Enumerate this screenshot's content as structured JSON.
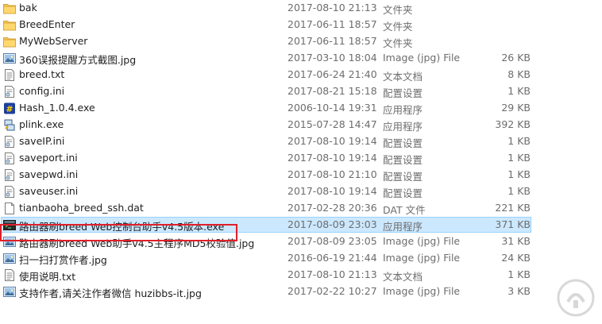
{
  "files": [
    {
      "name": "bak",
      "date": "2017-08-10 21:13",
      "type": "文件夹",
      "size": "",
      "icon": "folder-icon"
    },
    {
      "name": "BreedEnter",
      "date": "2017-06-11 18:57",
      "type": "文件夹",
      "size": "",
      "icon": "folder-icon"
    },
    {
      "name": "MyWebServer",
      "date": "2017-06-11 18:57",
      "type": "文件夹",
      "size": "",
      "icon": "folder-icon"
    },
    {
      "name": "360误报提醒方式截图.jpg",
      "date": "2017-03-10 18:04",
      "type": "Image (jpg) File",
      "size": "26 KB",
      "icon": "image-file-icon"
    },
    {
      "name": "breed.txt",
      "date": "2017-06-24 21:40",
      "type": "文本文档",
      "size": "8 KB",
      "icon": "text-file-icon"
    },
    {
      "name": "config.ini",
      "date": "2017-08-21 15:18",
      "type": "配置设置",
      "size": "1 KB",
      "icon": "settings-file-icon"
    },
    {
      "name": "Hash_1.0.4.exe",
      "date": "2006-10-14 19:31",
      "type": "应用程序",
      "size": "29 KB",
      "icon": "hash-app-icon"
    },
    {
      "name": "plink.exe",
      "date": "2015-07-28 14:47",
      "type": "应用程序",
      "size": "392 KB",
      "icon": "plink-app-icon"
    },
    {
      "name": "saveIP.ini",
      "date": "2017-08-10 19:14",
      "type": "配置设置",
      "size": "1 KB",
      "icon": "settings-file-icon"
    },
    {
      "name": "saveport.ini",
      "date": "2017-08-10 19:14",
      "type": "配置设置",
      "size": "1 KB",
      "icon": "settings-file-icon"
    },
    {
      "name": "savepwd.ini",
      "date": "2017-08-10 21:10",
      "type": "配置设置",
      "size": "1 KB",
      "icon": "settings-file-icon"
    },
    {
      "name": "saveuser.ini",
      "date": "2017-08-10 19:14",
      "type": "配置设置",
      "size": "1 KB",
      "icon": "settings-file-icon"
    },
    {
      "name": "tianbaoha_breed_ssh.dat",
      "date": "2017-02-28 20:36",
      "type": "DAT 文件",
      "size": "221 KB",
      "icon": "blank-file-icon"
    },
    {
      "name": "路由器刷breed Web控制台助手v4.5版本.exe",
      "date": "2017-08-09 23:03",
      "type": "应用程序",
      "size": "371 KB",
      "icon": "console-app-icon",
      "selected": true
    },
    {
      "name": "路由器刷breed Web助手v4.5主程序MD5校验值.jpg",
      "date": "2017-08-09 23:05",
      "type": "Image (jpg) File",
      "size": "31 KB",
      "icon": "image-file-icon"
    },
    {
      "name": "扫一扫打赏作者.jpg",
      "date": "2016-06-19 21:44",
      "type": "Image (jpg) File",
      "size": "24 KB",
      "icon": "image-file-icon"
    },
    {
      "name": "使用说明.txt",
      "date": "2017-08-10 21:13",
      "type": "文本文档",
      "size": "1 KB",
      "icon": "text-file-icon"
    },
    {
      "name": "支持作者,请关注作者微信 huzibbs-it.jpg",
      "date": "2017-02-22 10:27",
      "type": "Image (jpg) File",
      "size": "3 KB",
      "icon": "image-file-icon"
    }
  ],
  "colors": {
    "selection_bg": "#cce8ff",
    "selection_border": "#99d1ff",
    "highlight_box": "#e0202a",
    "folder": "#f5c659"
  },
  "watermark": {
    "icon": "smzdm-logo-icon"
  }
}
